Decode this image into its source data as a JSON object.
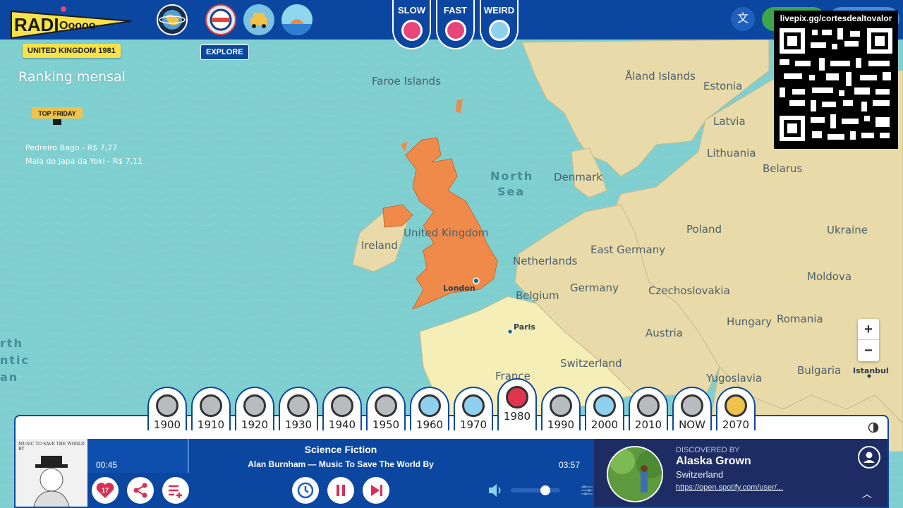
{
  "app": {
    "name": "RADIOoooo"
  },
  "topbar": {
    "speed_buttons": [
      {
        "label": "SLOW",
        "color": "#e8457a"
      },
      {
        "label": "FAST",
        "color": "#e8457a"
      },
      {
        "label": "WEIRD",
        "color": "#8fd0ef"
      }
    ],
    "icons": [
      "globe-icon",
      "taxi-meter-icon",
      "taxi-icon",
      "island-icon",
      "translate-icon"
    ]
  },
  "country_badge": "UNITED KINGDOM 1981",
  "explore_label": "EXPLORE",
  "overlay": {
    "ranking_title": "Ranking mensal",
    "sponsor_logo_text": "TOP FRIDAY",
    "rankings": [
      "Pedreiro Bago - R$ 7,77",
      "Mala do Japa da Yoki - R$ 7,11"
    ],
    "qr_url": "livepix.gg/cortesdealtovalor"
  },
  "map": {
    "countries": [
      "Faroe Islands",
      "Åland Islands",
      "Estonia",
      "Latvia",
      "Lithuania",
      "Belarus",
      "Denmark",
      "United Kingdom",
      "Ireland",
      "Poland",
      "Ukraine",
      "East Germany",
      "Netherlands",
      "Moldova",
      "Belgium",
      "Germany",
      "Czechoslovakia",
      "Hungary",
      "Romania",
      "Austria",
      "Switzerland",
      "France",
      "Yugoslavia",
      "Bulgaria"
    ],
    "seas": [
      "North",
      "Sea",
      "rth",
      "ntic",
      "an"
    ],
    "cities": [
      "London",
      "Paris",
      "Istanbul"
    ],
    "colors": {
      "sea": "#7fcfd0",
      "land": "#e9dba9",
      "land_light": "#f6eeb7",
      "selected": "#ef8a4a"
    },
    "zoom_in": "+",
    "zoom_out": "−"
  },
  "decades": [
    {
      "year": "1900",
      "state": "inactive"
    },
    {
      "year": "1910",
      "state": "inactive"
    },
    {
      "year": "1920",
      "state": "inactive"
    },
    {
      "year": "1930",
      "state": "inactive"
    },
    {
      "year": "1940",
      "state": "inactive"
    },
    {
      "year": "1950",
      "state": "inactive"
    },
    {
      "year": "1960",
      "state": "available"
    },
    {
      "year": "1970",
      "state": "available"
    },
    {
      "year": "1980",
      "state": "selected"
    },
    {
      "year": "1990",
      "state": "inactive"
    },
    {
      "year": "2000",
      "state": "available"
    },
    {
      "year": "2010",
      "state": "inactive"
    },
    {
      "year": "NOW",
      "state": "inactive"
    },
    {
      "year": "2070",
      "state": "future"
    }
  ],
  "player": {
    "track_title": "Science Fiction",
    "track_artist": "Alan Burnham — Music To Save The World By",
    "time_elapsed": "00:45",
    "time_total": "03:57",
    "progress": 0.2,
    "likes": "17",
    "volume": 0.7,
    "cover_text": "MUSIC TO SAVE THE WORLD BY",
    "discovered": {
      "label": "DISCOVERED BY",
      "name": "Alaska Grown",
      "country": "Switzerland",
      "link": "https://open.spotify.com/user/..."
    }
  }
}
